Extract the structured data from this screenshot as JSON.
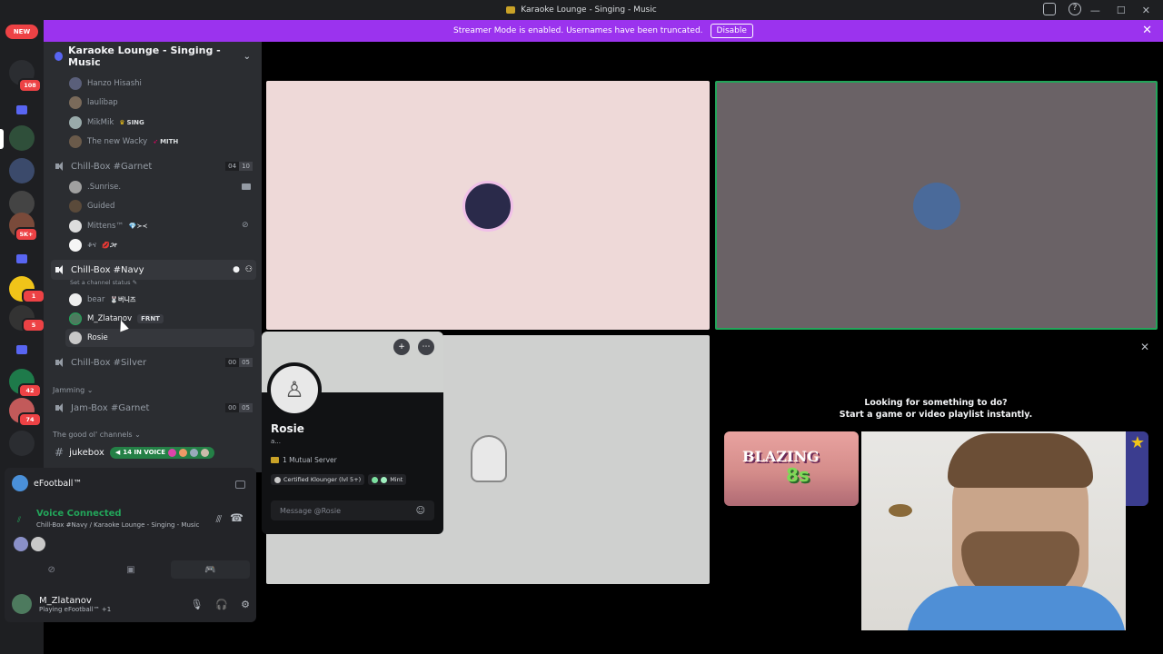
{
  "window": {
    "title": "Karaoke Lounge - Singing - Music"
  },
  "banner": {
    "text": "Streamer Mode is enabled. Usernames have been truncated.",
    "button": "Disable"
  },
  "rail": {
    "new_label": "NEW",
    "badges": [
      "108",
      "1",
      "5K+",
      "1",
      "5",
      "42",
      "74"
    ]
  },
  "guild": {
    "name": "Karaoke Lounge - Singing - Music"
  },
  "sidebar": {
    "users_top": [
      {
        "name": "Hanzo Hisashi",
        "tag": ""
      },
      {
        "name": "laulibap",
        "tag": ""
      },
      {
        "name": "MikMik",
        "tag": "SING"
      },
      {
        "name": "The new Wacky",
        "tag": "MITH"
      }
    ],
    "channel_garnet": {
      "name": "Chill-Box #Garnet",
      "count_a": "04",
      "count_b": "10"
    },
    "users_garnet": [
      {
        "name": ".Sunrise.",
        "tag": ""
      },
      {
        "name": "Guided",
        "tag": ""
      },
      {
        "name": "Mittens™",
        "tag": "💎≻≺"
      },
      {
        "name": "ቆና",
        "tag": "💋ጋየ"
      }
    ],
    "channel_navy": {
      "name": "Chill-Box #Navy",
      "status": "Set a channel status"
    },
    "users_navy": [
      {
        "name": "bear",
        "tag": "🐰버니즈"
      },
      {
        "name": "M_Zlatanov",
        "tag": "FRNT"
      },
      {
        "name": "Rosie",
        "tag": ""
      }
    ],
    "channel_silver": {
      "name": "Chill-Box #Silver",
      "count_a": "00",
      "count_b": "05"
    },
    "category_jamming": "Jamming",
    "channel_jam": {
      "name": "Jam-Box #Garnet",
      "count_a": "00",
      "count_b": "05"
    },
    "category_good": "The good ol' channels",
    "channel_jukebox": {
      "name": "jukebox",
      "voice_pill": "14 IN VOICE"
    }
  },
  "panel": {
    "game": "eFootball™",
    "voice_title": "Voice Connected",
    "voice_sub": "Chill-Box #Navy / Karaoke Lounge - Singing - Music",
    "user_name": "M_Zlatanov",
    "user_status": "Playing eFootball™ +1"
  },
  "popout": {
    "name": "Rosie",
    "tag": "a...",
    "mutual": "1 Mutual Server",
    "roles": [
      "Certified Klounger (lvl 5+)",
      "Mint"
    ],
    "message_placeholder": "Message @Rosie"
  },
  "activity": {
    "line1": "Looking for something to do?",
    "line2": "Start a game or video playlist instantly.",
    "game_logo": "BLAZING",
    "game_num": "8s"
  },
  "colors": {
    "accent": "#5865f2",
    "streamer_banner": "#9b33ee",
    "voice_green": "#23a55a",
    "danger": "#ed4245"
  }
}
